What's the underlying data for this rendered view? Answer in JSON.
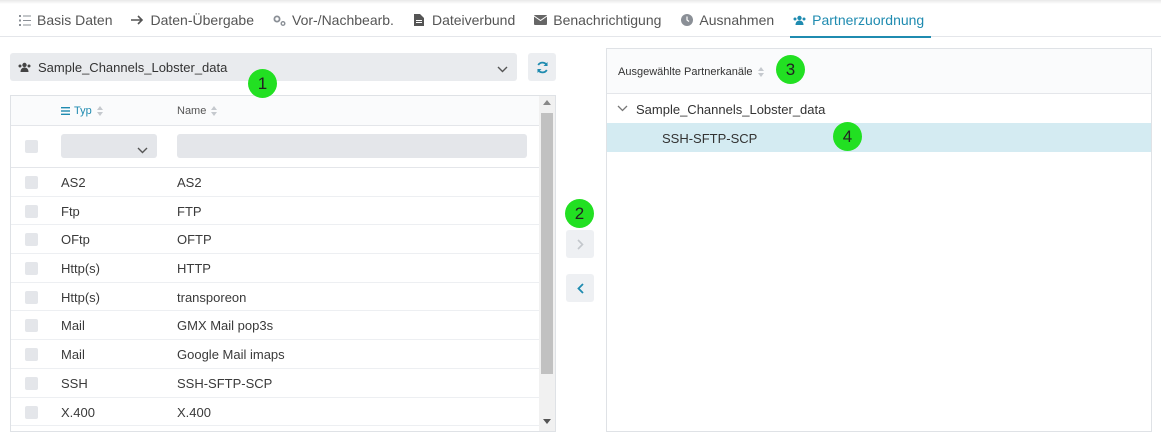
{
  "tabs": [
    {
      "label": "Basis Daten",
      "icon": "list-icon",
      "active": false
    },
    {
      "label": "Daten-Übergabe",
      "icon": "arrow-right-icon",
      "active": false
    },
    {
      "label": "Vor-/Nachbearb.",
      "icon": "gears-icon",
      "active": false
    },
    {
      "label": "Dateiverbund",
      "icon": "file-icon",
      "active": false
    },
    {
      "label": "Benachrichtigung",
      "icon": "envelope-icon",
      "active": false
    },
    {
      "label": "Ausnahmen",
      "icon": "clock-icon",
      "active": false
    },
    {
      "label": "Partnerzuordnung",
      "icon": "users-icon",
      "active": true
    }
  ],
  "partner_select": {
    "value": "Sample_Channels_Lobster_data"
  },
  "grid": {
    "columns": {
      "typ": "Typ",
      "name": "Name"
    },
    "filter": {
      "typ_value": "",
      "name_value": ""
    },
    "rows": [
      {
        "typ": "AS2",
        "name": "AS2"
      },
      {
        "typ": "Ftp",
        "name": "FTP"
      },
      {
        "typ": "OFtp",
        "name": "OFTP"
      },
      {
        "typ": "Http(s)",
        "name": "HTTP"
      },
      {
        "typ": "Http(s)",
        "name": "transporeon"
      },
      {
        "typ": "Mail",
        "name": "GMX Mail pop3s"
      },
      {
        "typ": "Mail",
        "name": "Google Mail imaps"
      },
      {
        "typ": "SSH",
        "name": "SSH-SFTP-SCP"
      },
      {
        "typ": "X.400",
        "name": "X.400"
      }
    ]
  },
  "selected": {
    "header": "Ausgewählte Partnerkanäle",
    "root": "Sample_Channels_Lobster_data",
    "children": [
      "SSH-SFTP-SCP"
    ]
  },
  "markers": [
    "1",
    "2",
    "3",
    "4"
  ],
  "colors": {
    "accent": "#1f8bb0",
    "marker": "#22e022",
    "selected_row": "#d4ebf2"
  }
}
